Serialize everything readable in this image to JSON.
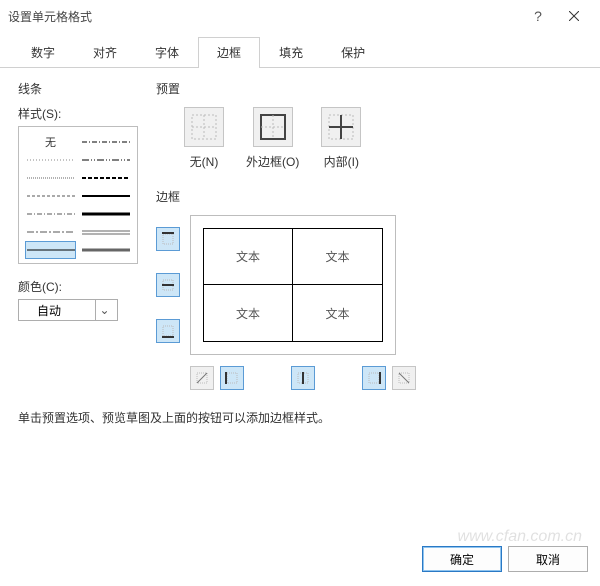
{
  "title": "设置单元格格式",
  "tabs": [
    "数字",
    "对齐",
    "字体",
    "边框",
    "填充",
    "保护"
  ],
  "activeTab": 3,
  "line": {
    "group": "线条",
    "styleLabel": "样式(S):",
    "noneText": "无",
    "colorLabel": "颜色(C):",
    "colorValue": "自动"
  },
  "preset": {
    "group": "预置",
    "none": "无(N)",
    "outline": "外边框(O)",
    "inside": "内部(I)"
  },
  "border": {
    "group": "边框",
    "sample": "文本"
  },
  "hint": "单击预置选项、预览草图及上面的按钮可以添加边框样式。",
  "ok": "确定",
  "cancel": "取消",
  "watermark": "www.cfan.com.cn"
}
